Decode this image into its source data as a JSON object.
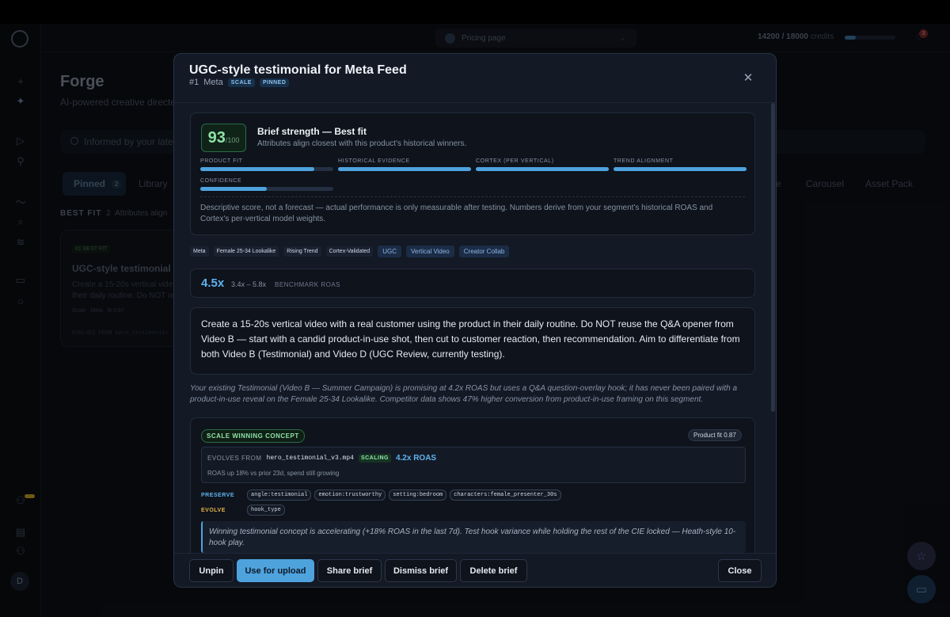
{
  "app": {
    "page_selector": "Pricing page",
    "credits_used": "14200 / 18000",
    "credits_label": "credits",
    "credits_fraction": 0.22,
    "notification_count": "3",
    "avatar_initial": "D"
  },
  "background": {
    "title": "Forge",
    "subtitle": "AI-powered creative directe",
    "info_text": "Informed by your late",
    "tabs": [
      {
        "label": "Pinned",
        "count": "2"
      },
      {
        "label": "Library"
      },
      {
        "label": "e"
      },
      {
        "label": "Carousel"
      },
      {
        "label": "Asset Pack"
      }
    ],
    "best_fit_label": "BEST FIT",
    "best_fit_count": "2",
    "best_fit_desc": "Attributes align",
    "card": {
      "tag": "#1 BEST FIT",
      "title": "UGC-style testimonial fo",
      "desc": "Create a 15-20s vertical vide their daily routine. Do NOT re",
      "chips": [
        "Scale",
        "Meta",
        "fit 0.87"
      ],
      "evolves": "EVOLVES FROM hero_testimonial"
    }
  },
  "modal": {
    "title": "UGC-style testimonial for Meta Feed",
    "rank": "#1",
    "platform": "Meta",
    "badges": [
      "SCALE",
      "PINNED"
    ],
    "strength": {
      "score": "93",
      "score_max": "/100",
      "title": "Brief strength — Best fit",
      "subtitle": "Attributes align closest with this product's historical winners.",
      "metrics": [
        {
          "label": "PRODUCT FIT",
          "value": 0.86
        },
        {
          "label": "HISTORICAL EVIDENCE",
          "value": 1.0
        },
        {
          "label": "CORTEX (PER VERTICAL)",
          "value": 1.0
        },
        {
          "label": "TREND ALIGNMENT",
          "value": 1.0
        },
        {
          "label": "CONFIDENCE",
          "value": 0.5
        }
      ],
      "disclaimer": "Descriptive score, not a forecast — actual performance is only measurable after testing. Numbers derive from your segment's historical ROAS and Cortex's per-vertical model weights."
    },
    "tags": [
      "Meta",
      "Female 25-34 Lookalike",
      "Rising Trend",
      "Cortex-Validated"
    ],
    "format_tags": [
      "UGC",
      "Vertical Video",
      "Creator Collab"
    ],
    "roas": {
      "value": "4.5x",
      "range": "3.4x – 5.8x",
      "label": "BENCHMARK ROAS"
    },
    "brief_text": "Create a 15-20s vertical video with a real customer using the product in their daily routine. Do NOT reuse the Q&A opener from Video B — start with a candid product-in-use shot, then cut to customer reaction, then recommendation. Aim to differentiate from both Video B (Testimonial) and Video D (UGC Review, currently testing).",
    "context_note": "Your existing Testimonial (Video B — Summer Campaign) is promising at 4.2x ROAS but uses a Q&A question-overlay hook; it has never been paired with a product-in-use reveal on the Female 25-34 Lookalike. Competitor data shows 47% higher conversion from product-in-use framing on this segment.",
    "concept": {
      "badge": "SCALE WINNING CONCEPT",
      "product_fit": "Product fit 0.87",
      "evolves_label": "EVOLVES FROM",
      "evolves_file": "hero_testimonial_v3.mp4",
      "status": "SCALING",
      "roas": "4.2x ROAS",
      "trend": "ROAS up 18% vs prior 23d, spend still growing",
      "preserve_label": "PRESERVE",
      "preserve": [
        "angle:testimonial",
        "emotion:trustworthy",
        "setting:bedroom",
        "characters:female_presenter_30s"
      ],
      "evolve_label": "EVOLVE",
      "evolve": [
        "hook_type"
      ],
      "rationale": "Winning testimonial concept is accelerating (+18% ROAS in the last 7d). Test hook variance while holding the rest of the CIE locked — Heath-style 10-hook play."
    },
    "footer": {
      "unpin": "Unpin",
      "use_for_upload": "Use for upload",
      "share": "Share brief",
      "dismiss": "Dismiss brief",
      "delete": "Delete brief",
      "close": "Close"
    }
  }
}
